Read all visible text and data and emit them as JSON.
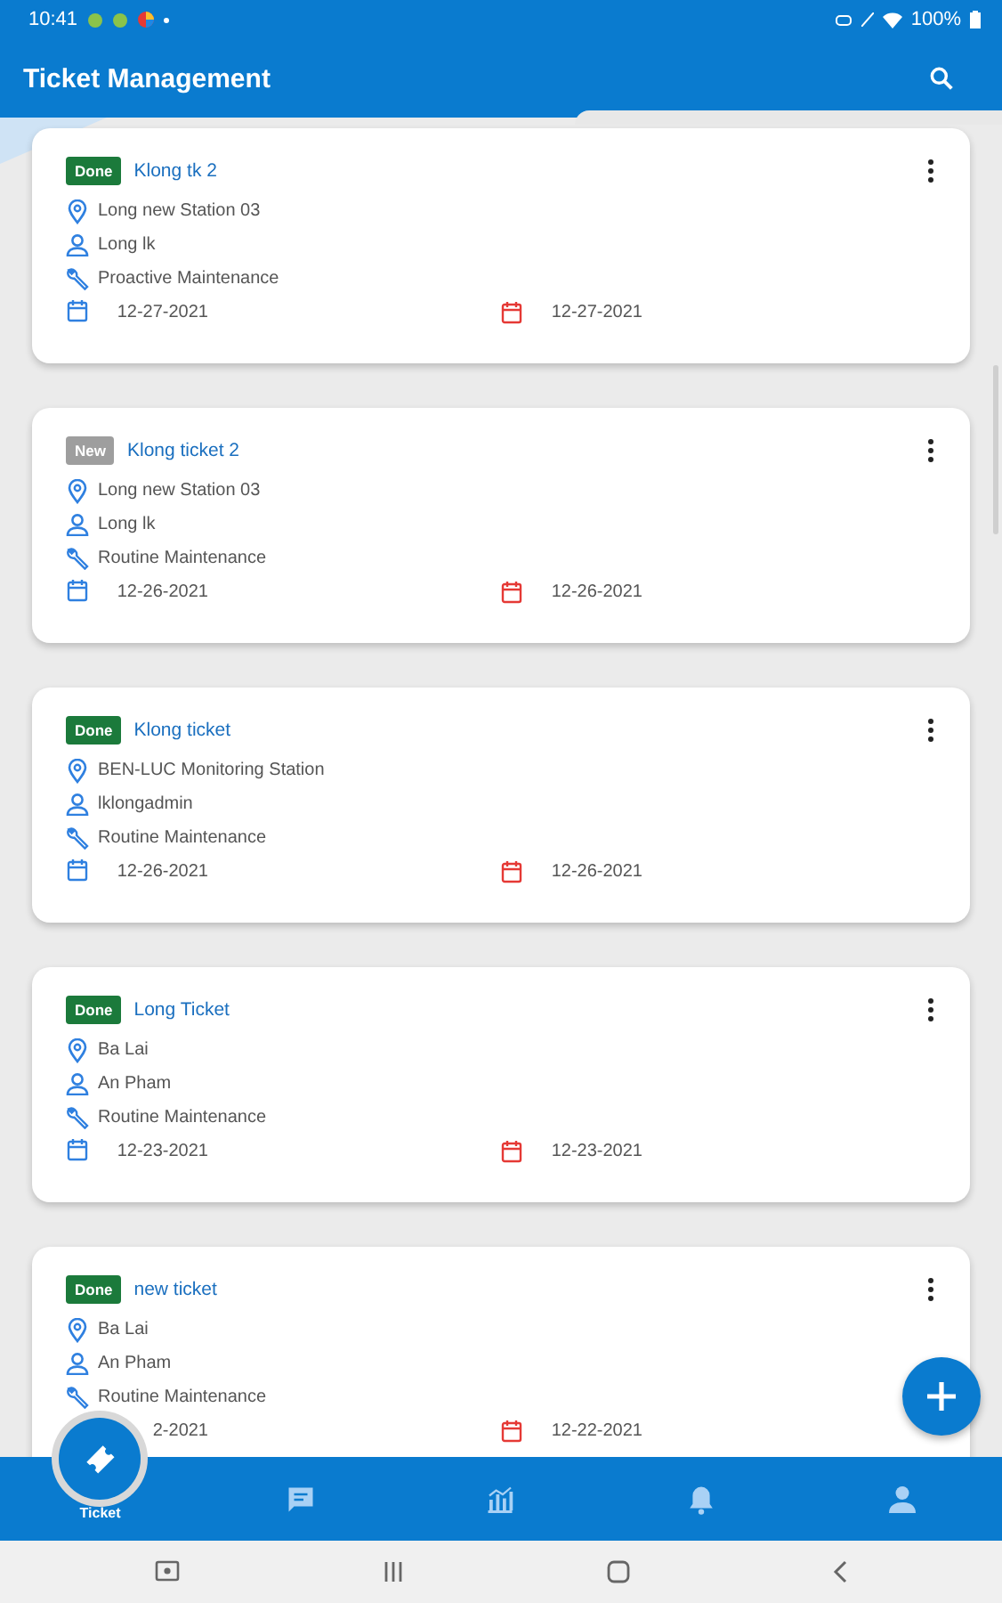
{
  "status_bar": {
    "time": "10:41",
    "battery": "100%"
  },
  "app_bar": {
    "title": "Ticket Management"
  },
  "tickets": [
    {
      "status": "Done",
      "title": "Klong tk 2",
      "station": "Long new Station 03",
      "assignee": "Long lk",
      "type": "Proactive Maintenance",
      "start_date": "12-27-2021",
      "end_date": "12-27-2021",
      "start_cut": false
    },
    {
      "status": "New",
      "title": "Klong ticket 2",
      "station": "Long new Station 03",
      "assignee": "Long lk",
      "type": "Routine Maintenance",
      "start_date": "12-26-2021",
      "end_date": "12-26-2021",
      "start_cut": false
    },
    {
      "status": "Done",
      "title": "Klong ticket",
      "station": "BEN-LUC Monitoring Station",
      "assignee": "lklongadmin",
      "type": "Routine Maintenance",
      "start_date": "12-26-2021",
      "end_date": "12-26-2021",
      "start_cut": false
    },
    {
      "status": "Done",
      "title": "Long Ticket",
      "station": "Ba Lai",
      "assignee": "An Pham",
      "type": "Routine Maintenance",
      "start_date": "12-23-2021",
      "end_date": "12-23-2021",
      "start_cut": false
    },
    {
      "status": "Done",
      "title": "new ticket",
      "station": "Ba Lai",
      "assignee": "An Pham",
      "type": "Routine Maintenance",
      "start_date": "2-2021",
      "end_date": "12-22-2021",
      "start_cut": true
    }
  ],
  "bottom_nav": [
    {
      "kind": "ticket",
      "label": "Ticket",
      "selected": true
    },
    {
      "kind": "chat",
      "selected": false
    },
    {
      "kind": "chart",
      "selected": false
    },
    {
      "kind": "bell",
      "selected": false
    },
    {
      "kind": "person",
      "selected": false
    }
  ]
}
